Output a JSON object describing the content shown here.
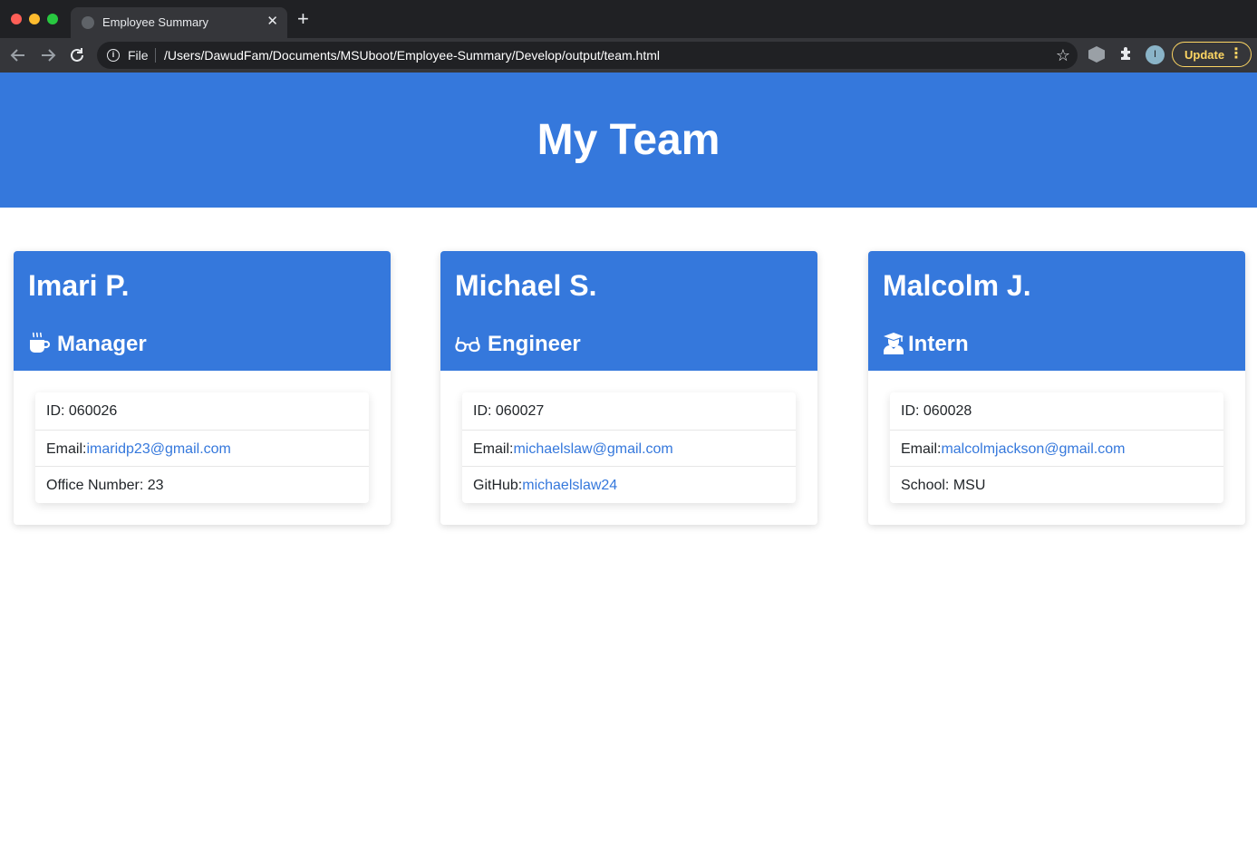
{
  "browser": {
    "tab_title": "Employee Summary",
    "tab_close": "✕",
    "new_tab": "+",
    "scheme_label": "File",
    "url": "/Users/DawudFam/Documents/MSUboot/Employee-Summary/Develop/output/team.html",
    "avatar_initial": "I",
    "update_label": "Update"
  },
  "page": {
    "title": "My Team"
  },
  "team": [
    {
      "name": "Imari P.",
      "role": "Manager",
      "role_icon": "mug-icon",
      "id_line": "ID: 060026",
      "email_prefix": "Email:",
      "email": "imaridp23@gmail.com",
      "extra_prefix": "Office Number: 23",
      "extra_link": ""
    },
    {
      "name": "Michael S.",
      "role": "Engineer",
      "role_icon": "glasses-icon",
      "id_line": "ID: 060027",
      "email_prefix": "Email:",
      "email": "michaelslaw@gmail.com",
      "extra_prefix": "GitHub:",
      "extra_link": "michaelslaw24"
    },
    {
      "name": "Malcolm J.",
      "role": "Intern",
      "role_icon": "graduate-icon",
      "id_line": "ID: 060028",
      "email_prefix": "Email:",
      "email": "malcolmjackson@gmail.com",
      "extra_prefix": "School: MSU",
      "extra_link": ""
    }
  ],
  "colors": {
    "primary": "#3578dc",
    "chrome_dark": "#202124",
    "chrome_toolbar": "#35363a",
    "update_accent": "#fdd663"
  }
}
